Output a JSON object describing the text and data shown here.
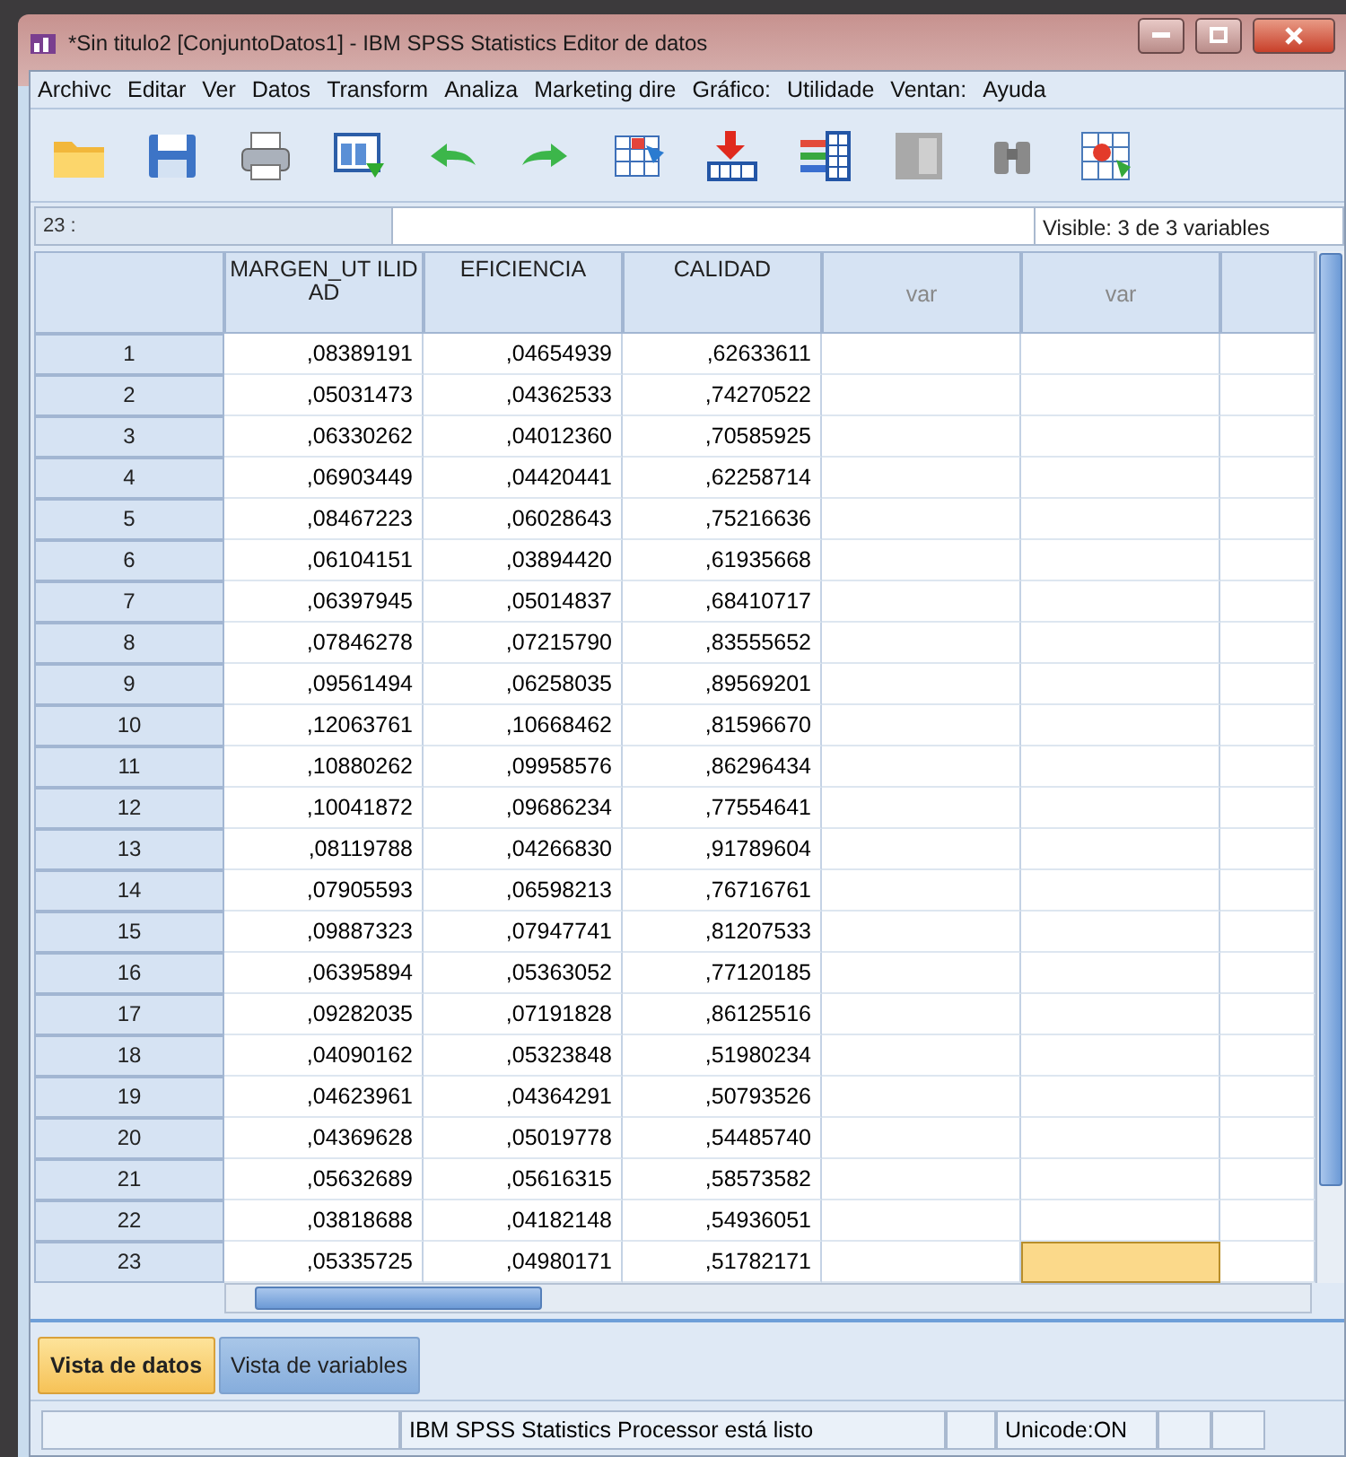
{
  "window": {
    "title": "*Sin titulo2 [ConjuntoDatos1] - IBM SPSS Statistics Editor de datos"
  },
  "menu": [
    "Archivc",
    "Editar",
    "Ver",
    "Datos",
    "Transform",
    "Analiza",
    "Marketing dire",
    "Gráfico:",
    "Utilidade",
    "Ventan:",
    "Ayuda"
  ],
  "toolbar": [
    {
      "kind": "open"
    },
    {
      "kind": "save"
    },
    {
      "kind": "print"
    },
    {
      "kind": "dialog"
    },
    {
      "kind": "undo"
    },
    {
      "kind": "redo"
    },
    {
      "kind": "goto"
    },
    {
      "kind": "insert"
    },
    {
      "kind": "vars"
    },
    {
      "kind": "split"
    },
    {
      "kind": "find"
    },
    {
      "kind": "weight"
    }
  ],
  "cell_editor": {
    "cell_ref": "23 :",
    "visible": "Visible: 3 de 3 variables"
  },
  "columns": [
    {
      "label": "MARGEN_UT ILIDAD",
      "kind": "variable"
    },
    {
      "label": "EFICIENCIA",
      "kind": "variable"
    },
    {
      "label": "CALIDAD",
      "kind": "variable"
    },
    {
      "label": "var",
      "kind": "empty"
    },
    {
      "label": "var",
      "kind": "empty"
    }
  ],
  "rows": [
    {
      "n": "1",
      "values": [
        ",08389191",
        ",04654939",
        ",62633611"
      ],
      "selected": false
    },
    {
      "n": "2",
      "values": [
        ",05031473",
        ",04362533",
        ",74270522"
      ],
      "selected": false
    },
    {
      "n": "3",
      "values": [
        ",06330262",
        ",04012360",
        ",70585925"
      ],
      "selected": false
    },
    {
      "n": "4",
      "values": [
        ",06903449",
        ",04420441",
        ",62258714"
      ],
      "selected": false
    },
    {
      "n": "5",
      "values": [
        ",08467223",
        ",06028643",
        ",75216636"
      ],
      "selected": false
    },
    {
      "n": "6",
      "values": [
        ",06104151",
        ",03894420",
        ",61935668"
      ],
      "selected": false
    },
    {
      "n": "7",
      "values": [
        ",06397945",
        ",05014837",
        ",68410717"
      ],
      "selected": false
    },
    {
      "n": "8",
      "values": [
        ",07846278",
        ",07215790",
        ",83555652"
      ],
      "selected": false
    },
    {
      "n": "9",
      "values": [
        ",09561494",
        ",06258035",
        ",89569201"
      ],
      "selected": false
    },
    {
      "n": "10",
      "values": [
        ",12063761",
        ",10668462",
        ",81596670"
      ],
      "selected": false
    },
    {
      "n": "11",
      "values": [
        ",10880262",
        ",09958576",
        ",86296434"
      ],
      "selected": false
    },
    {
      "n": "12",
      "values": [
        ",10041872",
        ",09686234",
        ",77554641"
      ],
      "selected": false
    },
    {
      "n": "13",
      "values": [
        ",08119788",
        ",04266830",
        ",91789604"
      ],
      "selected": false
    },
    {
      "n": "14",
      "values": [
        ",07905593",
        ",06598213",
        ",76716761"
      ],
      "selected": false
    },
    {
      "n": "15",
      "values": [
        ",09887323",
        ",07947741",
        ",81207533"
      ],
      "selected": false
    },
    {
      "n": "16",
      "values": [
        ",06395894",
        ",05363052",
        ",77120185"
      ],
      "selected": false
    },
    {
      "n": "17",
      "values": [
        ",09282035",
        ",07191828",
        ",86125516"
      ],
      "selected": false
    },
    {
      "n": "18",
      "values": [
        ",04090162",
        ",05323848",
        ",51980234"
      ],
      "selected": false
    },
    {
      "n": "19",
      "values": [
        ",04623961",
        ",04364291",
        ",50793526"
      ],
      "selected": false
    },
    {
      "n": "20",
      "values": [
        ",04369628",
        ",05019778",
        ",54485740"
      ],
      "selected": false
    },
    {
      "n": "21",
      "values": [
        ",05632689",
        ",05616315",
        ",58573582"
      ],
      "selected": false
    },
    {
      "n": "22",
      "values": [
        ",03818688",
        ",04182148",
        ",54936051"
      ],
      "selected": false
    },
    {
      "n": "23",
      "values": [
        ",05335725",
        ",04980171",
        ",51782171"
      ],
      "selected": true
    }
  ],
  "tabs": [
    {
      "label": "Vista de datos",
      "selected": true
    },
    {
      "label": "Vista de variables",
      "selected": false
    }
  ],
  "status_bar": {
    "message": "IBM SPSS Statistics Processor está listo",
    "encoding": "Unicode:ON"
  }
}
